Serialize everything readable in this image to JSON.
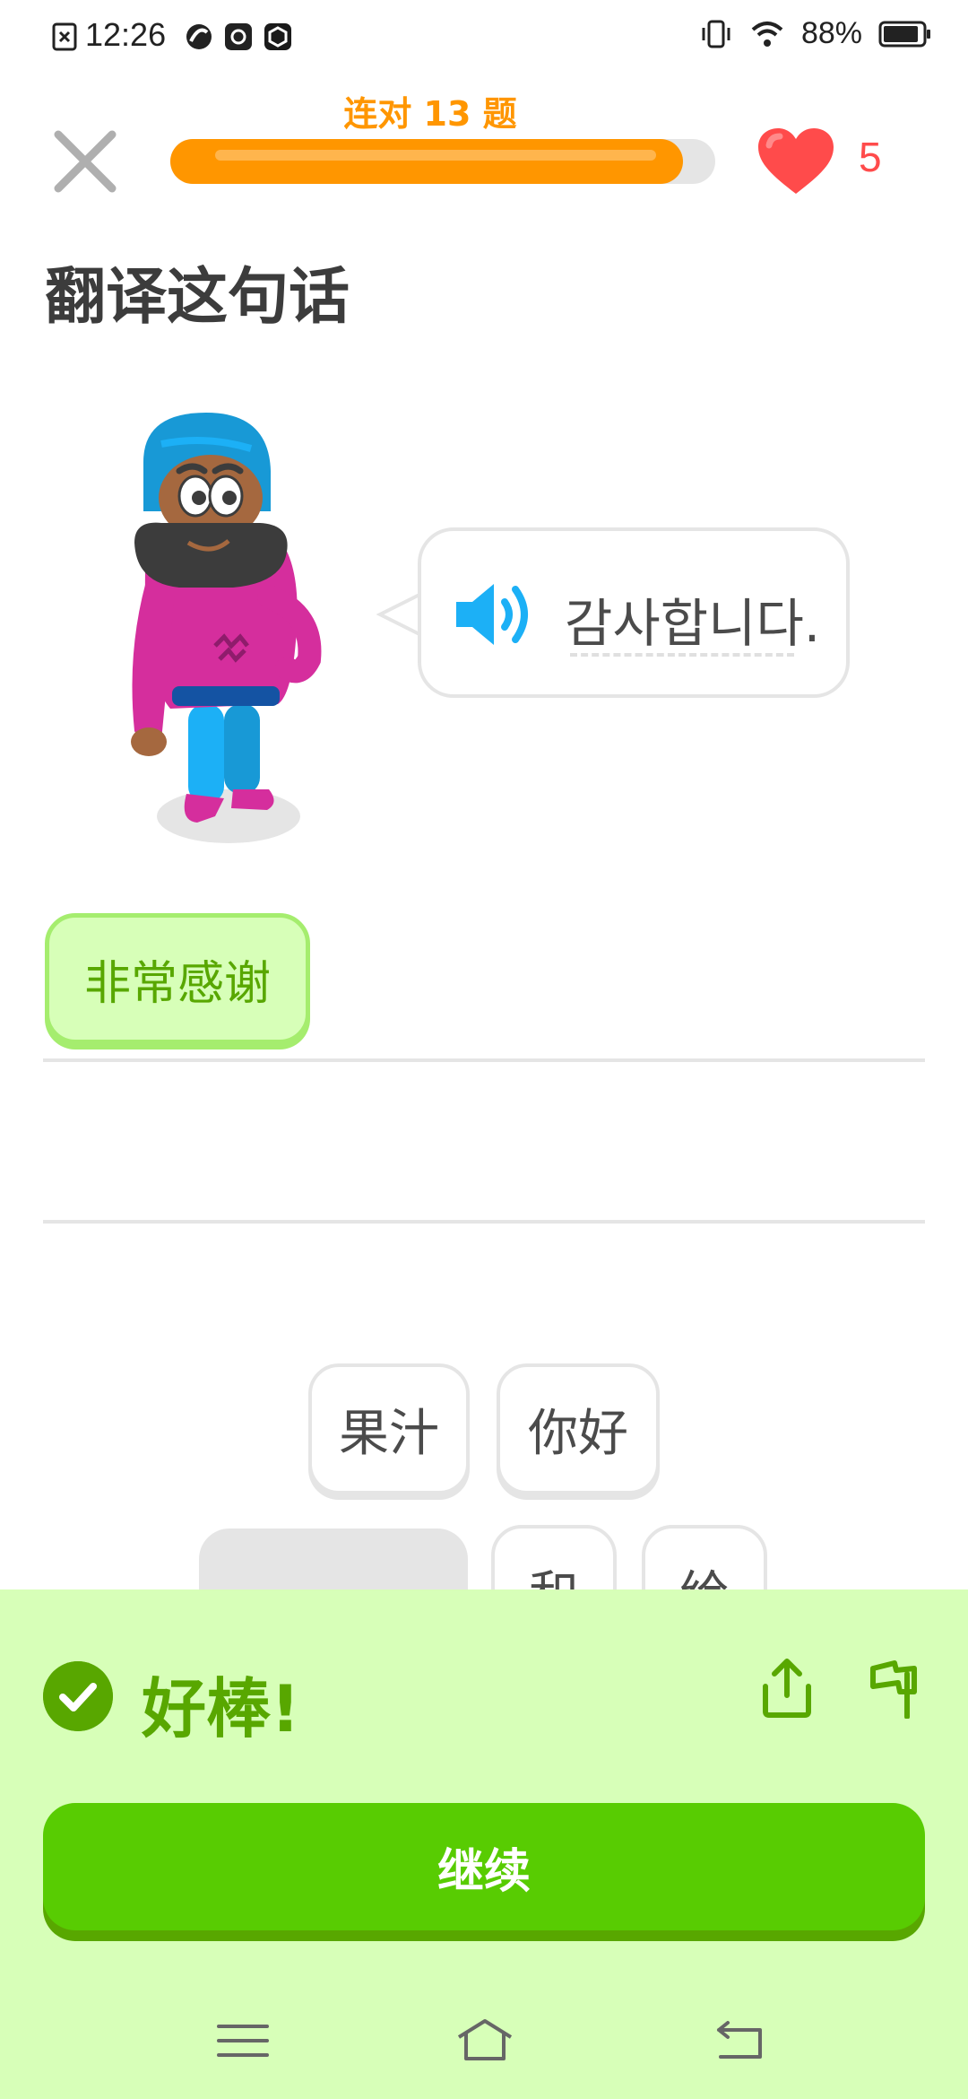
{
  "status_bar": {
    "time": "12:26",
    "battery": "88%",
    "icons": [
      "screenshot-icon",
      "app-icon",
      "app-icon",
      "app-icon",
      "vibrate-icon",
      "wifi-icon",
      "battery-icon"
    ]
  },
  "header": {
    "streak_text": "连对 13 题",
    "progress_fraction": 0.94,
    "hearts": "5",
    "close_icon": "close-icon",
    "heart_icon": "heart-icon"
  },
  "exercise": {
    "title": "翻译这句话",
    "prompt": "감사합니다.",
    "speaker_icon": "speaker-icon"
  },
  "answer": {
    "selected_words": [
      "非常感谢"
    ]
  },
  "word_bank": {
    "row1": [
      "果汁",
      "你好"
    ],
    "row2": [
      "和",
      "给"
    ]
  },
  "feedback": {
    "message": "好棒!",
    "continue_label": "继续",
    "colors": {
      "panel": "#d7ffb8",
      "accent": "#58a700",
      "button": "#58cc02"
    }
  },
  "nav_bar": {
    "icons": [
      "menu-icon",
      "home-icon",
      "back-icon"
    ]
  }
}
